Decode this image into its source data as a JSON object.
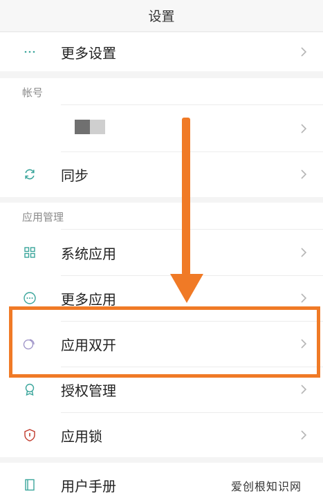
{
  "header": {
    "title": "设置"
  },
  "more_settings": {
    "label": "更多设置",
    "icon": "dots-icon"
  },
  "account": {
    "section_title": "帐号",
    "sync_label": "同步"
  },
  "app_management": {
    "section_title": "应用管理",
    "items": [
      {
        "label": "系统应用",
        "icon": "grid-icon"
      },
      {
        "label": "更多应用",
        "icon": "ellipsis-circle-icon"
      },
      {
        "label": "应用双开",
        "icon": "dual-circle-icon"
      },
      {
        "label": "授权管理",
        "icon": "badge-icon"
      },
      {
        "label": "应用锁",
        "icon": "shield-icon"
      }
    ]
  },
  "bottom": {
    "user_manual_label": "用户手册"
  },
  "watermark": "爱创根知识网",
  "colors": {
    "accent": "#f07a26",
    "icon": "#3aa59b"
  }
}
